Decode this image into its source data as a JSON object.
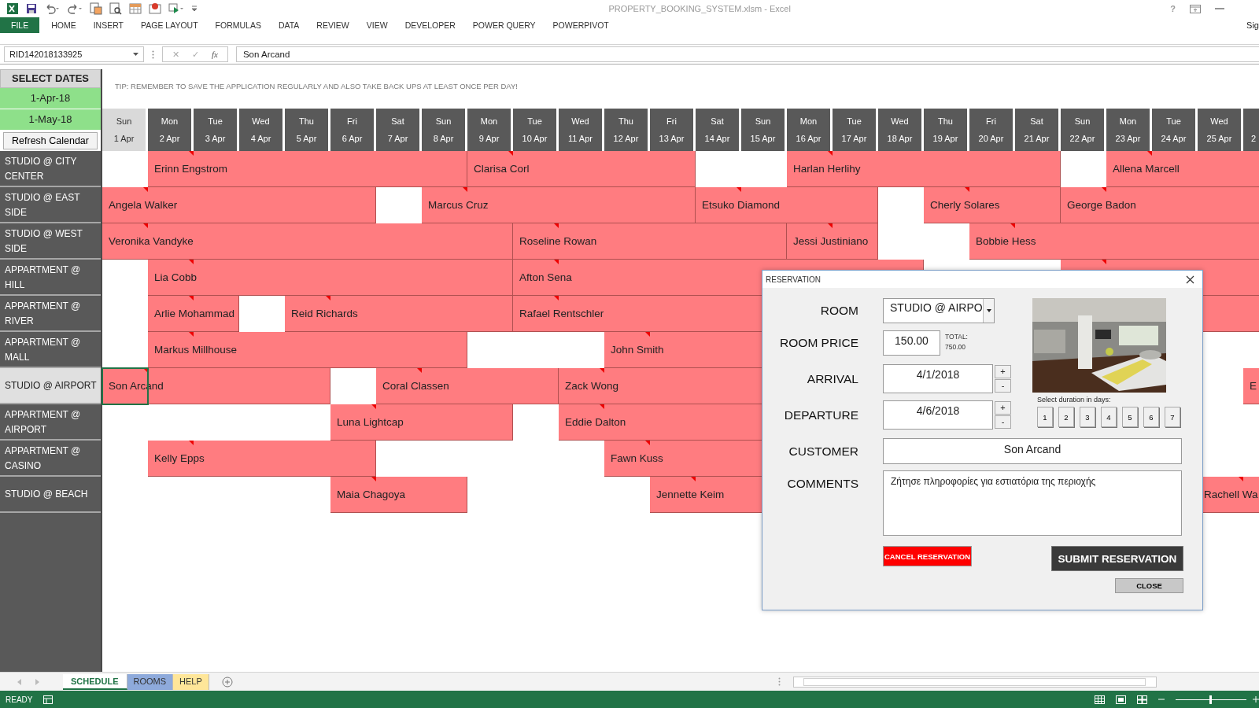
{
  "window": {
    "title": "PROPERTY_BOOKING_SYSTEM.xlsm - Excel",
    "help": "?",
    "account": "Sig"
  },
  "ribbon_tabs": [
    {
      "label": "FILE",
      "selected": true
    },
    {
      "label": "HOME",
      "selected": false
    },
    {
      "label": "INSERT",
      "selected": false
    },
    {
      "label": "PAGE LAYOUT",
      "selected": false
    },
    {
      "label": "FORMULAS",
      "selected": false
    },
    {
      "label": "DATA",
      "selected": false
    },
    {
      "label": "REVIEW",
      "selected": false
    },
    {
      "label": "VIEW",
      "selected": false
    },
    {
      "label": "DEVELOPER",
      "selected": false
    },
    {
      "label": "POWER QUERY",
      "selected": false
    },
    {
      "label": "POWERPIVOT",
      "selected": false
    }
  ],
  "formula_bar": {
    "name_box": "RID142018133925",
    "cancel": "✕",
    "enter": "✓",
    "function": "fx",
    "value": "Son Arcand"
  },
  "controls": {
    "title": "SELECT DATES",
    "start_date": "1-Apr-18",
    "end_date": "1-May-18",
    "refresh_button": "Refresh Calendar"
  },
  "tip": "TIP: REMEMBER TO SAVE THE APPLICATION REGULARLY AND ALSO TAKE BACK UPS AT LEAST ONCE PER DAY!",
  "days": [
    {
      "dow": "Sun",
      "date": "1 Apr",
      "today": true
    },
    {
      "dow": "Mon",
      "date": "2 Apr",
      "today": false
    },
    {
      "dow": "Tue",
      "date": "3 Apr",
      "today": false
    },
    {
      "dow": "Wed",
      "date": "4 Apr",
      "today": false
    },
    {
      "dow": "Thu",
      "date": "5 Apr",
      "today": false
    },
    {
      "dow": "Fri",
      "date": "6 Apr",
      "today": false
    },
    {
      "dow": "Sat",
      "date": "7 Apr",
      "today": false
    },
    {
      "dow": "Sun",
      "date": "8 Apr",
      "today": false
    },
    {
      "dow": "Mon",
      "date": "9 Apr",
      "today": false
    },
    {
      "dow": "Tue",
      "date": "10 Apr",
      "today": false
    },
    {
      "dow": "Wed",
      "date": "11 Apr",
      "today": false
    },
    {
      "dow": "Thu",
      "date": "12 Apr",
      "today": false
    },
    {
      "dow": "Fri",
      "date": "13 Apr",
      "today": false
    },
    {
      "dow": "Sat",
      "date": "14 Apr",
      "today": false
    },
    {
      "dow": "Sun",
      "date": "15 Apr",
      "today": false
    },
    {
      "dow": "Mon",
      "date": "16 Apr",
      "today": false
    },
    {
      "dow": "Tue",
      "date": "17 Apr",
      "today": false
    },
    {
      "dow": "Wed",
      "date": "18 Apr",
      "today": false
    },
    {
      "dow": "Thu",
      "date": "19 Apr",
      "today": false
    },
    {
      "dow": "Fri",
      "date": "20 Apr",
      "today": false
    },
    {
      "dow": "Sat",
      "date": "21 Apr",
      "today": false
    },
    {
      "dow": "Sun",
      "date": "22 Apr",
      "today": false
    },
    {
      "dow": "Mon",
      "date": "23 Apr",
      "today": false
    },
    {
      "dow": "Tue",
      "date": "24 Apr",
      "today": false
    },
    {
      "dow": "Wed",
      "date": "25 Apr",
      "today": false
    },
    {
      "date": "2",
      "today": false
    }
  ],
  "rooms": [
    {
      "label": "STUDIO @ CITY CENTER",
      "selected": false,
      "cells": [
        {
          "kind": "free"
        },
        {
          "kind": "booking",
          "name": "Erinn Engstrom",
          "selected": false
        },
        {
          "kind": "stay"
        },
        {
          "kind": "stay"
        },
        {
          "kind": "stay"
        },
        {
          "kind": "stay"
        },
        {
          "kind": "stay"
        },
        {
          "kind": "stay"
        },
        {
          "kind": "booking",
          "name": "Clarisa Corl",
          "selected": false
        },
        {
          "kind": "stay"
        },
        {
          "kind": "stay"
        },
        {
          "kind": "stay"
        },
        {
          "kind": "stay"
        },
        {
          "kind": "free"
        },
        {
          "kind": "free"
        },
        {
          "kind": "booking",
          "name": "Harlan Herlihy",
          "selected": false
        },
        {
          "kind": "stay"
        },
        {
          "kind": "stay"
        },
        {
          "kind": "stay"
        },
        {
          "kind": "stay"
        },
        {
          "kind": "stay"
        },
        {
          "kind": "free"
        },
        {
          "kind": "booking",
          "name": "Allena Marcell",
          "selected": false
        },
        {
          "kind": "stay"
        },
        {
          "kind": "stay"
        },
        {
          "kind": "stay"
        }
      ]
    },
    {
      "label": "STUDIO @ EAST SIDE",
      "selected": false,
      "cells": [
        {
          "kind": "booking",
          "name": "Angela Walker",
          "selected": false
        },
        {
          "kind": "stay"
        },
        {
          "kind": "stay"
        },
        {
          "kind": "stay"
        },
        {
          "kind": "stay"
        },
        {
          "kind": "stay"
        },
        {
          "kind": "free"
        },
        {
          "kind": "booking",
          "name": "Marcus Cruz",
          "selected": false
        },
        {
          "kind": "stay"
        },
        {
          "kind": "stay"
        },
        {
          "kind": "stay"
        },
        {
          "kind": "stay"
        },
        {
          "kind": "stay"
        },
        {
          "kind": "booking",
          "name": "Etsuko Diamond",
          "selected": false
        },
        {
          "kind": "stay"
        },
        {
          "kind": "stay"
        },
        {
          "kind": "stay"
        },
        {
          "kind": "free"
        },
        {
          "kind": "booking",
          "name": "Cherly Solares",
          "selected": false
        },
        {
          "kind": "stay"
        },
        {
          "kind": "stay"
        },
        {
          "kind": "booking",
          "name": "George Badon",
          "selected": false
        },
        {
          "kind": "stay"
        },
        {
          "kind": "stay"
        },
        {
          "kind": "stay"
        },
        {
          "kind": "stay"
        }
      ]
    },
    {
      "label": "STUDIO @ WEST SIDE",
      "selected": false,
      "cells": [
        {
          "kind": "booking",
          "name": "Veronika Vandyke",
          "selected": false
        },
        {
          "kind": "stay"
        },
        {
          "kind": "stay"
        },
        {
          "kind": "stay"
        },
        {
          "kind": "stay"
        },
        {
          "kind": "stay"
        },
        {
          "kind": "stay"
        },
        {
          "kind": "stay"
        },
        {
          "kind": "stay"
        },
        {
          "kind": "booking",
          "name": "Roseline Rowan",
          "selected": false
        },
        {
          "kind": "stay"
        },
        {
          "kind": "stay"
        },
        {
          "kind": "stay"
        },
        {
          "kind": "stay"
        },
        {
          "kind": "stay"
        },
        {
          "kind": "booking",
          "name": "Jessi Justiniano",
          "selected": false
        },
        {
          "kind": "stay"
        },
        {
          "kind": "free"
        },
        {
          "kind": "free"
        },
        {
          "kind": "booking",
          "name": "Bobbie Hess",
          "selected": false
        },
        {
          "kind": "stay"
        },
        {
          "kind": "stay"
        },
        {
          "kind": "stay"
        },
        {
          "kind": "stay"
        },
        {
          "kind": "stay"
        },
        {
          "kind": "stay"
        }
      ]
    },
    {
      "label": "APPARTMENT @ HILL",
      "selected": false,
      "cells": [
        {
          "kind": "free"
        },
        {
          "kind": "booking",
          "name": "Lia Cobb",
          "selected": false
        },
        {
          "kind": "stay"
        },
        {
          "kind": "stay"
        },
        {
          "kind": "stay"
        },
        {
          "kind": "stay"
        },
        {
          "kind": "stay"
        },
        {
          "kind": "stay"
        },
        {
          "kind": "stay"
        },
        {
          "kind": "booking",
          "name": "Afton Sena",
          "selected": false
        },
        {
          "kind": "stay"
        },
        {
          "kind": "stay"
        },
        {
          "kind": "stay"
        },
        {
          "kind": "stay"
        },
        {
          "kind": "stay"
        },
        {
          "kind": "stay"
        },
        {
          "kind": "stay"
        },
        {
          "kind": "stay"
        },
        {
          "kind": "free"
        },
        {
          "kind": "free"
        },
        {
          "kind": "free"
        },
        {
          "kind": "booking",
          "selected": false
        },
        {
          "kind": "stay"
        },
        {
          "kind": "stay"
        },
        {
          "kind": "stay"
        },
        {
          "kind": "stay"
        }
      ]
    },
    {
      "label": "APPARTMENT @ RIVER",
      "selected": false,
      "cells": [
        {
          "kind": "free"
        },
        {
          "kind": "booking",
          "name": "Arlie Mohammad",
          "selected": false
        },
        {
          "kind": "stay"
        },
        {
          "kind": "free"
        },
        {
          "kind": "booking",
          "name": "Reid Richards",
          "selected": false
        },
        {
          "kind": "stay"
        },
        {
          "kind": "stay"
        },
        {
          "kind": "stay"
        },
        {
          "kind": "stay"
        },
        {
          "kind": "booking",
          "name": "Rafael Rentschler",
          "selected": false
        },
        {
          "kind": "stay"
        },
        {
          "kind": "stay"
        },
        {
          "kind": "stay"
        },
        {
          "kind": "stay"
        },
        {
          "kind": "stay"
        },
        {
          "kind": "stay"
        },
        {
          "kind": "stay"
        },
        {
          "kind": "stay"
        },
        {
          "kind": "stay"
        },
        {
          "kind": "stay"
        },
        {
          "kind": "stay"
        },
        {
          "kind": "stay"
        },
        {
          "kind": "stay"
        },
        {
          "kind": "stay"
        },
        {
          "kind": "stay"
        },
        {
          "kind": "stay"
        }
      ]
    },
    {
      "label": "APPARTMENT @ MALL",
      "selected": false,
      "cells": [
        {
          "kind": "free"
        },
        {
          "kind": "booking",
          "name": "Markus Millhouse",
          "selected": false
        },
        {
          "kind": "stay"
        },
        {
          "kind": "stay"
        },
        {
          "kind": "stay"
        },
        {
          "kind": "stay"
        },
        {
          "kind": "stay"
        },
        {
          "kind": "stay"
        },
        {
          "kind": "free"
        },
        {
          "kind": "free"
        },
        {
          "kind": "free"
        },
        {
          "kind": "booking",
          "name": "John Smith",
          "selected": false
        },
        {
          "kind": "stay"
        },
        {
          "kind": "stay"
        },
        {
          "kind": "stay"
        },
        {
          "kind": "stay"
        },
        {
          "kind": "stay"
        },
        {
          "kind": "free"
        },
        {
          "kind": "free"
        },
        {
          "kind": "free"
        },
        {
          "kind": "free"
        },
        {
          "kind": "free"
        },
        {
          "kind": "free"
        },
        {
          "kind": "free"
        },
        {
          "kind": "free"
        },
        {
          "kind": "free"
        }
      ]
    },
    {
      "label": "STUDIO @ AIRPORT",
      "selected": true,
      "cells": [
        {
          "kind": "booking",
          "name": "Son Arcand",
          "selected": true
        },
        {
          "kind": "stay"
        },
        {
          "kind": "stay"
        },
        {
          "kind": "stay"
        },
        {
          "kind": "stay"
        },
        {
          "kind": "free"
        },
        {
          "kind": "booking",
          "name": "Coral Classen",
          "selected": false
        },
        {
          "kind": "stay"
        },
        {
          "kind": "stay"
        },
        {
          "kind": "stay"
        },
        {
          "kind": "booking",
          "name": "Zack Wong",
          "selected": false
        },
        {
          "kind": "stay"
        },
        {
          "kind": "stay"
        },
        {
          "kind": "stay"
        },
        {
          "kind": "stay"
        },
        {
          "kind": "stay"
        },
        {
          "kind": "free"
        },
        {
          "kind": "free"
        },
        {
          "kind": "free"
        },
        {
          "kind": "free"
        },
        {
          "kind": "free"
        },
        {
          "kind": "free"
        },
        {
          "kind": "free"
        },
        {
          "kind": "free"
        },
        {
          "kind": "free"
        },
        {
          "kind": "booking",
          "name": "E",
          "selected": false
        }
      ]
    },
    {
      "label": "APPARTMENT @ AIRPORT",
      "selected": false,
      "cells": [
        {
          "kind": "free"
        },
        {
          "kind": "free"
        },
        {
          "kind": "free"
        },
        {
          "kind": "free"
        },
        {
          "kind": "free"
        },
        {
          "kind": "booking",
          "name": "Luna Lightcap",
          "selected": false
        },
        {
          "kind": "stay"
        },
        {
          "kind": "stay"
        },
        {
          "kind": "stay"
        },
        {
          "kind": "free"
        },
        {
          "kind": "booking",
          "name": "Eddie Dalton",
          "selected": false
        },
        {
          "kind": "stay"
        },
        {
          "kind": "stay"
        },
        {
          "kind": "stay"
        },
        {
          "kind": "stay"
        },
        {
          "kind": "free"
        },
        {
          "kind": "free"
        },
        {
          "kind": "free"
        },
        {
          "kind": "free"
        },
        {
          "kind": "free"
        },
        {
          "kind": "free"
        },
        {
          "kind": "free"
        },
        {
          "kind": "free"
        },
        {
          "kind": "free"
        },
        {
          "kind": "free"
        },
        {
          "kind": "free"
        }
      ]
    },
    {
      "label": "APPARTMENT @ CASINO",
      "selected": false,
      "cells": [
        {
          "kind": "free"
        },
        {
          "kind": "booking",
          "name": "Kelly Epps",
          "selected": false
        },
        {
          "kind": "stay"
        },
        {
          "kind": "stay"
        },
        {
          "kind": "stay"
        },
        {
          "kind": "stay"
        },
        {
          "kind": "free"
        },
        {
          "kind": "free"
        },
        {
          "kind": "free"
        },
        {
          "kind": "free"
        },
        {
          "kind": "free"
        },
        {
          "kind": "booking",
          "name": "Fawn Kuss",
          "selected": false
        },
        {
          "kind": "stay"
        },
        {
          "kind": "stay"
        },
        {
          "kind": "stay"
        },
        {
          "kind": "stay"
        },
        {
          "kind": "free"
        },
        {
          "kind": "free"
        },
        {
          "kind": "free"
        },
        {
          "kind": "free"
        },
        {
          "kind": "free"
        },
        {
          "kind": "free"
        },
        {
          "kind": "free"
        },
        {
          "kind": "free"
        },
        {
          "kind": "free"
        },
        {
          "kind": "free"
        }
      ]
    },
    {
      "label": "STUDIO @ BEACH",
      "selected": false,
      "cells": [
        {
          "kind": "free"
        },
        {
          "kind": "free"
        },
        {
          "kind": "free"
        },
        {
          "kind": "free"
        },
        {
          "kind": "free"
        },
        {
          "kind": "booking",
          "name": "Maia Chagoya",
          "selected": false
        },
        {
          "kind": "stay"
        },
        {
          "kind": "stay"
        },
        {
          "kind": "free"
        },
        {
          "kind": "free"
        },
        {
          "kind": "free"
        },
        {
          "kind": "free"
        },
        {
          "kind": "booking",
          "name": "Jennette Keim",
          "selected": false
        },
        {
          "kind": "stay"
        },
        {
          "kind": "stay"
        },
        {
          "kind": "stay"
        },
        {
          "kind": "free"
        },
        {
          "kind": "free"
        },
        {
          "kind": "free"
        },
        {
          "kind": "free"
        },
        {
          "kind": "free"
        },
        {
          "kind": "free"
        },
        {
          "kind": "free"
        },
        {
          "kind": "free"
        },
        {
          "kind": "booking",
          "name": "Rachell Wa",
          "selected": false
        },
        {
          "kind": "stay"
        }
      ]
    }
  ],
  "dialog": {
    "title": "RESERVATION",
    "room_label": "ROOM",
    "room": "STUDIO @ AIRPO",
    "price_label": "ROOM PRICE",
    "price": "150.00",
    "total_label": "TOTAL:",
    "total": "750.00",
    "arrival_label": "ARRIVAL",
    "arrival": "4/1/2018",
    "departure_label": "DEPARTURE",
    "departure": "4/6/2018",
    "spin": [
      "+",
      "-"
    ],
    "duration_label": "Select duration in days:",
    "durations": [
      "1",
      "2",
      "3",
      "4",
      "5",
      "6",
      "7"
    ],
    "customer_label": "CUSTOMER",
    "customer": "Son Arcand",
    "comments_label": "COMMENTS",
    "comments": "Ζήτησε πληροφορίες για εστιατόρια της περιοχής",
    "cancel_button": "CANCEL RESERVATION",
    "submit_button": "SUBMIT RESERVATION",
    "close_button": "CLOSE"
  },
  "sheet_tabs": [
    {
      "label": "SCHEDULE",
      "selected": true,
      "color": "#217346"
    },
    {
      "label": "ROOMS",
      "selected": false,
      "color": "#8eaadb"
    },
    {
      "label": "HELP",
      "selected": false,
      "color": "#ffe699"
    }
  ],
  "status": {
    "text": "READY"
  },
  "zoom": {
    "level": 0.5
  }
}
